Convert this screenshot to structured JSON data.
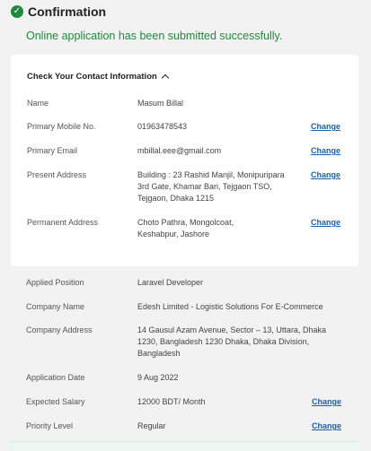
{
  "header": {
    "title": "Confirmation",
    "message": "Online application has been submitted successfully."
  },
  "contact": {
    "heading": "Check Your Contact Information",
    "rows": [
      {
        "label": "Name",
        "value": "Masum Billal",
        "change": ""
      },
      {
        "label": "Primary Mobile No.",
        "value": "01963478543",
        "change": "Change"
      },
      {
        "label": "Primary Email",
        "value": "mbillal.eee@gmail.com",
        "change": "Change"
      },
      {
        "label": "Present Address",
        "value": "Building : 23 Rashid Manjil, Monipuripara 3rd Gate, Khamar Bari, Tejgaon TSO, Tejgaon, Dhaka 1215",
        "change": "Change"
      },
      {
        "label": "Permanent Address",
        "value": "Choto Pathra, Mongolcoat, Keshabpur, Jashore",
        "change": "Change"
      }
    ]
  },
  "application": {
    "rows": [
      {
        "label": "Applied Position",
        "value": "Laravel Developer",
        "change": ""
      },
      {
        "label": "Company Name",
        "value": "Edesh Limited - Logistic Solutions For E-Commerce",
        "change": ""
      },
      {
        "label": "Company Address",
        "value": "14 Gausul Azam Avenue, Sector – 13, Uttara, Dhaka 1230, Bangladesh 1230 Dhaka, Dhaka Division, Bangladesh",
        "change": ""
      },
      {
        "label": "Application Date",
        "value": "9 Aug 2022",
        "change": ""
      },
      {
        "label": "Expected Salary",
        "value": "12000 BDT/ Month",
        "change": "Change"
      },
      {
        "label": "Priority Level",
        "value": "Regular",
        "change": "Change"
      }
    ]
  },
  "colors": {
    "success": "#22883c",
    "link": "#1f5fa8"
  }
}
